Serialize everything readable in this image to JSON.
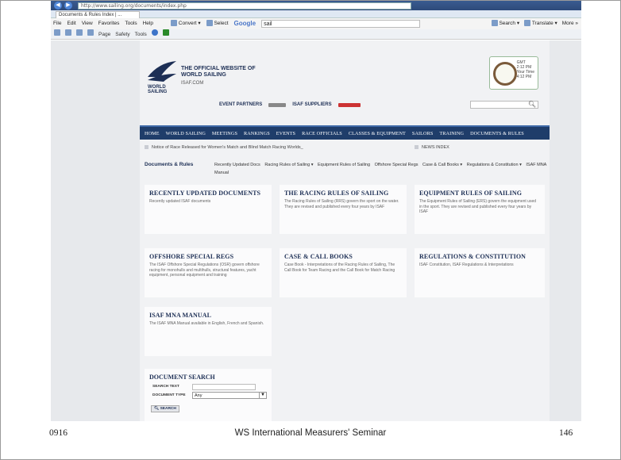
{
  "browser": {
    "url": "http://www.sailing.org/documents/index.php",
    "tab_title": "Documents & Rules Index | ...",
    "menus": [
      "File",
      "Edit",
      "View",
      "Favorites",
      "Tools",
      "Help"
    ],
    "toolbar_convert": "Convert",
    "toolbar_select": "Select",
    "google_label": "Google",
    "google_query": "sail",
    "search_label": "Search",
    "translate_label": "Translate",
    "more_label": "More",
    "cmd_items": [
      "Page",
      "Safety",
      "Tools"
    ]
  },
  "site": {
    "logo_text": "WORLD SAILING",
    "tagline": "THE OFFICIAL WEBSITE OF WORLD SAILING",
    "tagline_sub": "ISAF.COM",
    "clock_text": [
      "GMT",
      "2:12 PM",
      "Your Time",
      "4:12 PM"
    ],
    "event_partners": "EVENT PARTNERS",
    "isaf_suppliers": "ISAF SUPPLIERS",
    "main_nav": [
      "HOME",
      "WORLD SAILING",
      "MEETINGS",
      "RANKINGS",
      "EVENTS",
      "RACE OFFICIALS",
      "CLASSES & EQUIPMENT",
      "SAILORS",
      "TRAINING",
      "DOCUMENTS & RULES"
    ],
    "news_item": "Notice of Race Released for Women's Match and Blind Match Racing Worlds_",
    "news_index": "NEWS INDEX",
    "subnav_title": "Documents & Rules",
    "subnav_links": [
      "Recently Updated Docs",
      "Racing Rules of Sailing ▾",
      "Equipment Rules of Sailing",
      "Offshore Special Regs",
      "Case & Call Books ▾",
      "Regulations & Constitution ▾",
      "ISAF MNA Manual"
    ],
    "cards": [
      {
        "title": "RECENTLY UPDATED DOCUMENTS",
        "text": "Recently updated ISAF documents"
      },
      {
        "title": "THE RACING RULES OF SAILING",
        "text": "The Racing Rules of Sailing (RRS) govern the sport on the water. They are revised and published every four years by ISAF"
      },
      {
        "title": "EQUIPMENT RULES OF SAILING",
        "text": "The Equipment Rules of Sailing (ERS) govern the equipment used in the sport. They are revised and published every four years by ISAF"
      },
      {
        "title": "OFFSHORE SPECIAL REGS",
        "text": "The ISAF Offshore Special Regulations (OSR) govern offshore racing for monohulls and multihulls, structural features, yacht equipment, personal equipment and training"
      },
      {
        "title": "CASE & CALL BOOKS",
        "text": "Case Book - Interpretations of the Racing Rules of Sailing, The Call Book for Team Racing and the Call Book for Match Racing"
      },
      {
        "title": "REGULATIONS & CONSTITUTION",
        "text": "ISAF Constitution, ISAF Regulations & Interpretations"
      },
      {
        "title": "ISAF MNA MANUAL",
        "text": "The ISAF MNA Manual available in English, French and Spanish."
      }
    ],
    "doc_search": {
      "title": "DOCUMENT SEARCH",
      "search_text_label": "SEARCH TEXT",
      "doc_type_label": "DOCUMENT TYPE",
      "doc_type_value": "Any",
      "button": "SEARCH"
    }
  },
  "footer": {
    "code": "0916",
    "title": "WS International Measurers' Seminar",
    "page": "146"
  }
}
